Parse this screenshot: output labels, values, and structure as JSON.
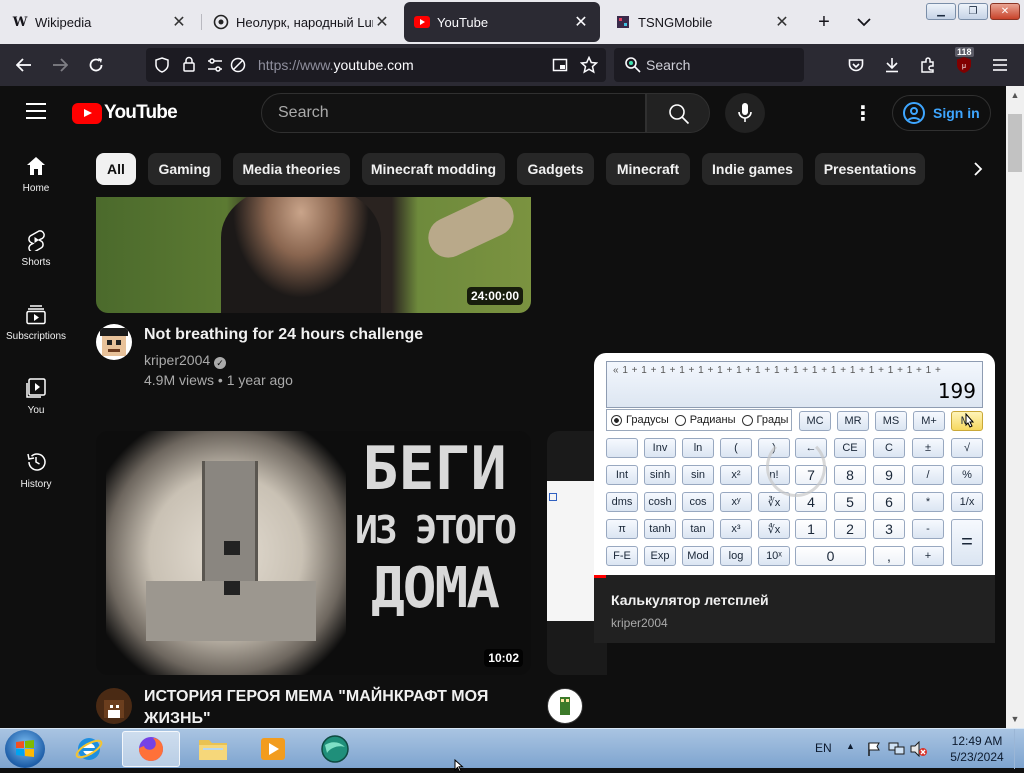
{
  "browser": {
    "tabs": [
      {
        "label": "Wikipedia",
        "favicon": "W",
        "active": false
      },
      {
        "label": "Неолурк, народный Lurkm",
        "favicon": "neolurk-icon",
        "active": false
      },
      {
        "label": "YouTube",
        "favicon": "youtube-icon",
        "active": true
      },
      {
        "label": "TSNGMobile",
        "favicon": "tsng-icon",
        "active": false
      }
    ],
    "url_protocol": "https://www.",
    "url_domain": "youtube.com",
    "search_placeholder": "Search",
    "extension_badge": "118"
  },
  "youtube": {
    "search_placeholder": "Search",
    "sign_in": "Sign in",
    "logo_text": "YouTube",
    "guide": [
      {
        "label": "Home",
        "icon": "home-icon"
      },
      {
        "label": "Shorts",
        "icon": "shorts-icon"
      },
      {
        "label": "Subscriptions",
        "icon": "subscriptions-icon"
      },
      {
        "label": "You",
        "icon": "you-icon"
      },
      {
        "label": "History",
        "icon": "history-icon"
      }
    ],
    "chips": [
      "All",
      "Gaming",
      "Media theories",
      "Minecraft modding",
      "Gadgets",
      "Minecraft",
      "Indie games",
      "Presentations"
    ],
    "videos": [
      {
        "title": "Not breathing for 24 hours challenge",
        "channel": "kriper2004",
        "meta": "4.9M views • 1 year ago",
        "duration": "24:00:00"
      },
      {
        "title": "ИСТОРИЯ ГЕРОЯ МЕМА \"МАЙНКРАФТ МОЯ ЖИЗНЬ\"",
        "duration": "10:02",
        "thumb_text": [
          "БЕГИ",
          "ИЗ ЭТОГО",
          "ДОМА"
        ]
      },
      {
        "title": "Калькулятор летсплей",
        "channel": "kriper2004"
      }
    ]
  },
  "calculator": {
    "expression": "« 1 + 1 + 1 + 1 + 1 + 1 + 1 + 1 + 1 + 1 + 1 + 1 + 1 + 1 + 1 + 1 + 1 +",
    "result": "199",
    "modes": [
      "Градусы",
      "Радианы",
      "Грады"
    ],
    "buttons": {
      "row1": [
        "MC",
        "MR",
        "MS",
        "M+",
        "M-"
      ],
      "row2": [
        "",
        "Inv",
        "ln",
        "(",
        ")",
        "←",
        "CE",
        "C",
        "±",
        "√"
      ],
      "row3": [
        "Int",
        "sinh",
        "sin",
        "x²",
        "n!",
        "7",
        "8",
        "9",
        "/",
        "%"
      ],
      "row4": [
        "dms",
        "cosh",
        "cos",
        "xʸ",
        "∛x",
        "4",
        "5",
        "6",
        "*",
        "1/x"
      ],
      "row5": [
        "π",
        "tanh",
        "tan",
        "x³",
        "∜x",
        "1",
        "2",
        "3",
        "-",
        "="
      ],
      "row6": [
        "F-E",
        "Exp",
        "Mod",
        "log",
        "10ˣ",
        "0",
        ",",
        "+"
      ]
    }
  },
  "taskbar": {
    "language": "EN",
    "time": "12:49 AM",
    "date": "5/23/2024"
  }
}
